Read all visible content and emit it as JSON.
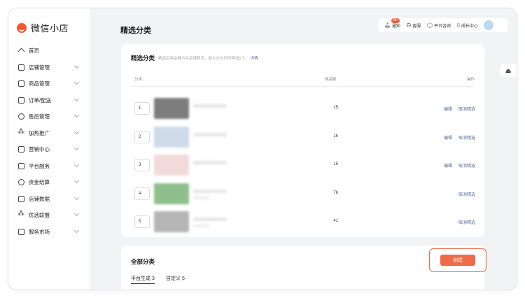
{
  "app": {
    "title": "微信小店"
  },
  "sidebar": {
    "items": [
      {
        "label": "首页",
        "icon": "home-icon",
        "has_children": false
      },
      {
        "label": "店铺管理",
        "icon": "store-icon",
        "has_children": true
      },
      {
        "label": "商品管理",
        "icon": "bag-icon",
        "has_children": true
      },
      {
        "label": "订单/配送",
        "icon": "order-icon",
        "has_children": true
      },
      {
        "label": "售后管理",
        "icon": "headset-icon",
        "has_children": true
      },
      {
        "label": "加热推广",
        "icon": "share-icon",
        "has_children": true
      },
      {
        "label": "营销中心",
        "icon": "coupon-icon",
        "has_children": true
      },
      {
        "label": "平台服务",
        "icon": "briefcase-icon",
        "has_children": true
      },
      {
        "label": "资金结算",
        "icon": "money-icon",
        "has_children": true
      },
      {
        "label": "店铺数据",
        "icon": "chart-icon",
        "has_children": true
      },
      {
        "label": "优选联盟",
        "icon": "network-icon",
        "has_children": true
      },
      {
        "label": "服务市场",
        "icon": "grid-icon",
        "has_children": true
      }
    ]
  },
  "topbar": {
    "notify": {
      "label": "通知",
      "badge": "99+"
    },
    "service": {
      "label": "客服"
    },
    "consult": {
      "label": "平台咨询"
    },
    "growth": {
      "label": "成长中心"
    }
  },
  "page": {
    "title": "精选分类"
  },
  "featured": {
    "title": "精选分类",
    "hint": "精选后将会展示在店铺首页，最大允许同时精选5个。",
    "hint_link": "详情",
    "headers": {
      "category": "分类",
      "count": "商品数",
      "action": "操作"
    },
    "rows": [
      {
        "index": "1",
        "count": "15",
        "edit": "编辑",
        "remove": "取消精选"
      },
      {
        "index": "2",
        "count": "15",
        "edit": "编辑",
        "remove": "取消精选"
      },
      {
        "index": "3",
        "count": "15",
        "edit": "编辑",
        "remove": "取消精选"
      },
      {
        "index": "4",
        "count": "76",
        "edit": "",
        "remove": "取消精选"
      },
      {
        "index": "5",
        "count": "41",
        "edit": "",
        "remove": "取消精选"
      }
    ]
  },
  "all": {
    "title": "全部分类",
    "create_label": "创建",
    "tabs": [
      {
        "label": "平台生成 3"
      },
      {
        "label": "自定义 5"
      }
    ]
  },
  "colors": {
    "accent": "#ef6a48",
    "link": "#576b95",
    "brand": "#ef5a34"
  }
}
